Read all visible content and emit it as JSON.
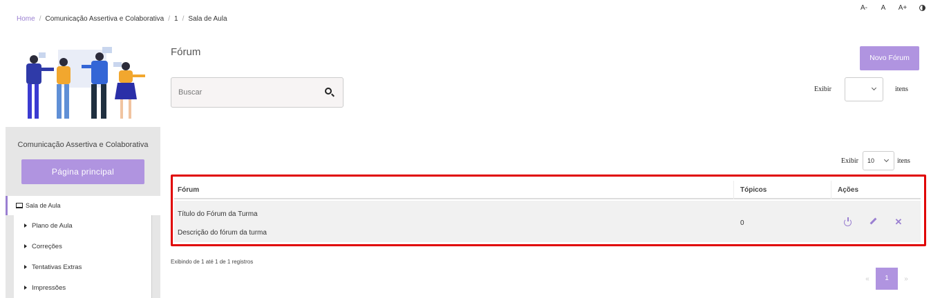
{
  "breadcrumb": {
    "home": "Home",
    "course": "Comunicação Assertiva e Colaborativa",
    "number": "1",
    "current": "Sala de Aula"
  },
  "accessibility": {
    "decrease": "A-",
    "normal": "A",
    "increase": "A+",
    "contrast_icon": "contrast-icon"
  },
  "sidebar": {
    "course_name": "Comunicação Assertiva e Colaborativa",
    "home_button": "Página principal",
    "menu_head": "Sala de Aula",
    "menu_icon": "monitor-icon",
    "items": [
      {
        "label": "Plano de Aula"
      },
      {
        "label": "Correções"
      },
      {
        "label": "Tentativas Extras"
      },
      {
        "label": "Impressões"
      }
    ]
  },
  "main": {
    "title": "Fórum",
    "new_button": "Novo Fórum",
    "search_placeholder": "Buscar",
    "show_top": {
      "label": "Exibir",
      "value": "",
      "suffix": "itens"
    },
    "show_bottom": {
      "label": "Exibir",
      "value": "10",
      "suffix": "itens"
    },
    "table": {
      "headers": [
        "Fórum",
        "Tópicos",
        "Ações"
      ],
      "rows": [
        {
          "title": "Título do Fórum da Turma",
          "description": "Descrição do fórum da turma",
          "topics": "0",
          "actions": [
            "power-icon",
            "edit-icon",
            "delete-icon"
          ]
        }
      ]
    },
    "records_info": "Exibindo de 1 até 1 de 1 registros",
    "pagination": {
      "prev": "«",
      "current": "1",
      "next": "»"
    }
  },
  "colors": {
    "accent": "#b094e0",
    "accent_dark": "#9a7fd1",
    "highlight_border": "#e00000",
    "sidebar_bg": "#e6e6e6"
  }
}
